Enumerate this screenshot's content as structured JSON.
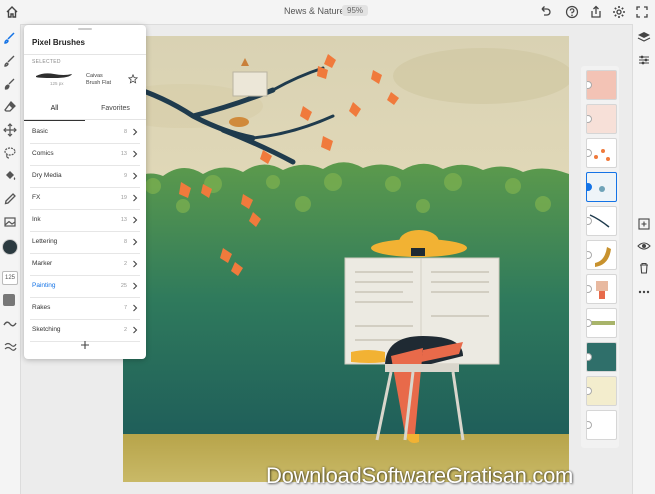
{
  "app": {
    "document_title": "News & Nature",
    "zoom_level": "95%"
  },
  "icons": {
    "home": "home-icon",
    "undo": "undo-icon",
    "help": "help-icon",
    "share": "share-icon",
    "settings": "gear-icon"
  },
  "toolbar": {
    "tools": [
      {
        "name": "pixel-brush-tool",
        "icon": "pixel-brush-icon",
        "active": true
      },
      {
        "name": "live-brush-tool",
        "icon": "live-brush-icon",
        "active": false
      },
      {
        "name": "vector-brush-tool",
        "icon": "vector-brush-icon",
        "active": false
      },
      {
        "name": "eraser-tool",
        "icon": "eraser-icon",
        "active": false
      },
      {
        "name": "transform-tool",
        "icon": "move-icon",
        "active": false
      },
      {
        "name": "selection-tool",
        "icon": "lasso-icon",
        "active": false
      },
      {
        "name": "fill-tool",
        "icon": "fill-bucket-icon",
        "active": false
      },
      {
        "name": "eyedropper-tool",
        "icon": "eyedropper-icon",
        "active": false
      },
      {
        "name": "image-tool",
        "icon": "image-icon",
        "active": false
      }
    ],
    "brush_size": "125",
    "current_color": "#2b3a40"
  },
  "brush_panel": {
    "title": "Pixel Brushes",
    "selected_label": "SELECTED",
    "selected_brush": {
      "name_line1": "Caivas",
      "name_line2": "Brush Flat",
      "size": "125 px"
    },
    "tabs": [
      "All",
      "Favorites"
    ],
    "categories": [
      {
        "name": "Basic",
        "count": "8"
      },
      {
        "name": "Comics",
        "count": "13"
      },
      {
        "name": "Dry Media",
        "count": "9"
      },
      {
        "name": "FX",
        "count": "19"
      },
      {
        "name": "Ink",
        "count": "13"
      },
      {
        "name": "Lettering",
        "count": "8"
      },
      {
        "name": "Marker",
        "count": "2"
      },
      {
        "name": "Painting",
        "count": "25"
      },
      {
        "name": "Rakes",
        "count": "7"
      },
      {
        "name": "Sketching",
        "count": "2"
      }
    ],
    "active_category": "Painting",
    "accent_color": "#1473e6"
  },
  "layers": {
    "count": 11,
    "selected_index": 3
  },
  "right_toolbar": {
    "icons": [
      "layers-icon",
      "layer-properties-icon",
      "add-layer-icon",
      "visibility-icon",
      "delete-icon",
      "more-icon"
    ]
  },
  "watermark": "DownloadSoftwareGratisan.com"
}
